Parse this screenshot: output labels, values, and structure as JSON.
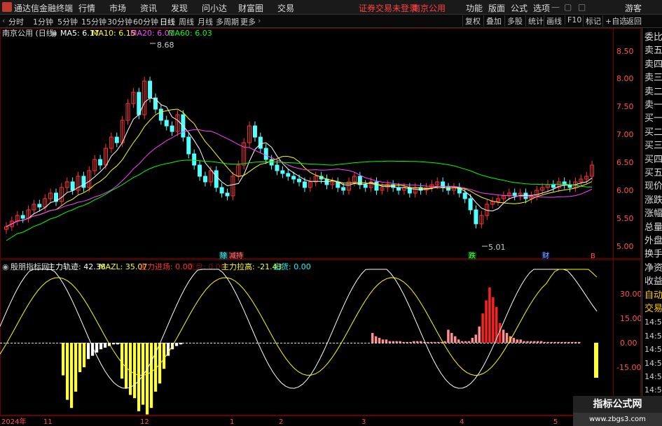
{
  "menubar": {
    "app_title": "通达信金融终端",
    "items": [
      "行情",
      "市场",
      "资讯",
      "发现",
      "问小达",
      "财富圈",
      "交易"
    ],
    "login_status": "证券交易未登录",
    "stock_name": "南京公用",
    "right_items": [
      "功能",
      "版面",
      "公式",
      "选项"
    ],
    "guest": "游客"
  },
  "tabbar": {
    "periods": [
      "分时",
      "1分钟",
      "5分钟",
      "15分钟",
      "30分钟",
      "60分钟",
      "日线",
      "周线",
      "月线",
      "多周期",
      "更多"
    ],
    "selected_index": 6,
    "tools": [
      "复权",
      "叠加",
      "多股",
      "统计",
      "画线",
      "F10",
      "标记",
      "+自选",
      "返回"
    ]
  },
  "main_chart": {
    "title": "南京公用 (日线)",
    "ma": [
      {
        "label": "MA5: 6.17",
        "color": "#ffffff"
      },
      {
        "label": "MA10: 6.15",
        "color": "#ffff00"
      },
      {
        "label": "MA20: 6.01",
        "color": "#ff40ff"
      },
      {
        "label": "MA60: 6.03",
        "color": "#00ff00"
      }
    ],
    "y_ticks": [
      "8.50",
      "8.00",
      "7.50",
      "7.00",
      "6.50",
      "6.00",
      "5.50",
      "5.00"
    ],
    "high_label": "8.68",
    "low_label": "5.01",
    "markers": [
      "除",
      "减持",
      "跌",
      "财",
      "B"
    ]
  },
  "indicator": {
    "name": "殷朋指标网",
    "items": [
      {
        "label": "主力轨迹: 42.38",
        "color": "#ffffff"
      },
      {
        "label": "MAZL: 35.07",
        "color": "#ffff00"
      },
      {
        "label": "主力进场: 0.00",
        "color": "#ff3030"
      },
      {
        "label": "洗盘: 0.00",
        "color": "#ff3030"
      },
      {
        "label": "主力拉高: -21.43",
        "color": "#ffff00"
      },
      {
        "label": "出货: 0.00",
        "color": "#00ffff"
      }
    ],
    "y_ticks": [
      "30.00",
      "15.00",
      "0.00",
      "-15.00"
    ]
  },
  "x_axis": [
    "2024年",
    "11",
    "12",
    "1",
    "2",
    "3",
    "4",
    "5"
  ],
  "sidebar": {
    "items": [
      "委比",
      "卖五",
      "卖四",
      "卖三",
      "卖二",
      "卖一",
      "买一",
      "买二",
      "买三",
      "买四",
      "买五",
      "现价",
      "涨跌",
      "涨幅",
      "总量",
      "外盘",
      "换手",
      "净资",
      "收益",
      "自动",
      "交易",
      "14:56",
      "14:56",
      "14:56",
      "14:56",
      "14:56",
      "14:56",
      "14:56"
    ]
  },
  "watermark": {
    "title": "指标公式网",
    "url": "www.zbgs3.com"
  },
  "colors": {
    "up": "#ff3333",
    "down": "#54ffff",
    "ma5": "#ffffff",
    "ma10": "#ffff00",
    "ma20": "#ff40ff",
    "ma60": "#00ff00"
  }
}
